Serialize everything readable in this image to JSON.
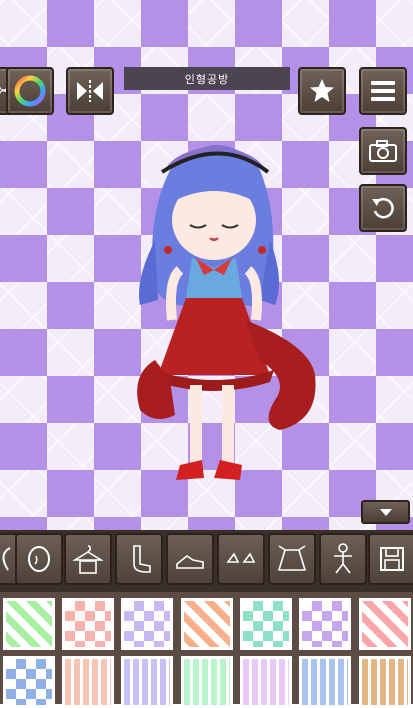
{
  "header": {
    "title": "인형공방"
  },
  "icons": {
    "color_wheel": "color-wheel-icon",
    "mirror": "flip-horizontal-icon",
    "favorite": "star-icon",
    "menu": "hamburger-menu-icon",
    "camera": "camera-icon",
    "reset": "rotate-left-icon",
    "collapse": "chevron-down-icon",
    "save": "floppy-disk-icon"
  },
  "categories": [
    "bangs",
    "face",
    "top",
    "socks",
    "shoes",
    "bows",
    "skirt",
    "pose",
    "save"
  ],
  "swatches_row1": [
    "#a7f0a2",
    "#f7b2ae",
    "#c7b8f3",
    "#f9b08a",
    "#8fe0c8",
    "#c6a6ec",
    "#f9a5a9"
  ],
  "swatches_row2": [
    "#8fb0e6",
    "#f9c4b6",
    "#c7c1f5",
    "#b9f3cc",
    "#e8c8f5",
    "#a8c4ee",
    "#e2b783"
  ],
  "colors": {
    "wood": "#4e423a",
    "tray": "#5c4c43",
    "title_bg": "#4a4550"
  }
}
